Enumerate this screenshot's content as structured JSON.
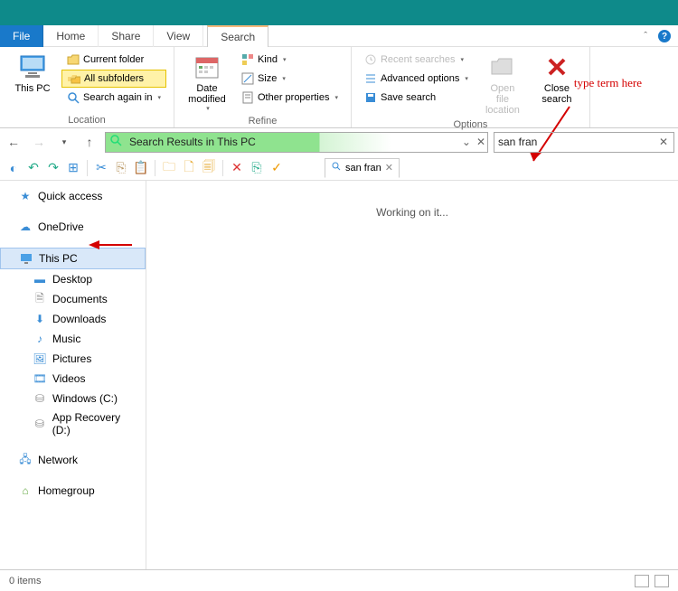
{
  "menu": {
    "file": "File",
    "home": "Home",
    "share": "Share",
    "view": "View",
    "search": "Search"
  },
  "ribbon": {
    "location": {
      "this_pc": "This PC",
      "current_folder": "Current folder",
      "all_subfolders": "All subfolders",
      "search_again": "Search again in",
      "group_label": "Location"
    },
    "refine": {
      "date_modified": "Date modified",
      "kind": "Kind",
      "size": "Size",
      "other_properties": "Other properties",
      "group_label": "Refine"
    },
    "options": {
      "recent_searches": "Recent searches",
      "advanced_options": "Advanced options",
      "save_search": "Save search",
      "open_file_location": "Open file location",
      "close_search": "Close search",
      "group_label": "Options"
    }
  },
  "annotation_text": "type term here",
  "address": {
    "text": "Search Results in This PC"
  },
  "search": {
    "value": "san fran"
  },
  "tabs": {
    "search_tab": "san fran"
  },
  "sidebar": {
    "quick_access": "Quick access",
    "onedrive": "OneDrive",
    "this_pc": "This PC",
    "desktop": "Desktop",
    "documents": "Documents",
    "downloads": "Downloads",
    "music": "Music",
    "pictures": "Pictures",
    "videos": "Videos",
    "windows_c": "Windows (C:)",
    "app_recovery_d": "App Recovery (D:)",
    "network": "Network",
    "homegroup": "Homegroup"
  },
  "content": {
    "working": "Working on it..."
  },
  "status": {
    "items": "0 items"
  }
}
